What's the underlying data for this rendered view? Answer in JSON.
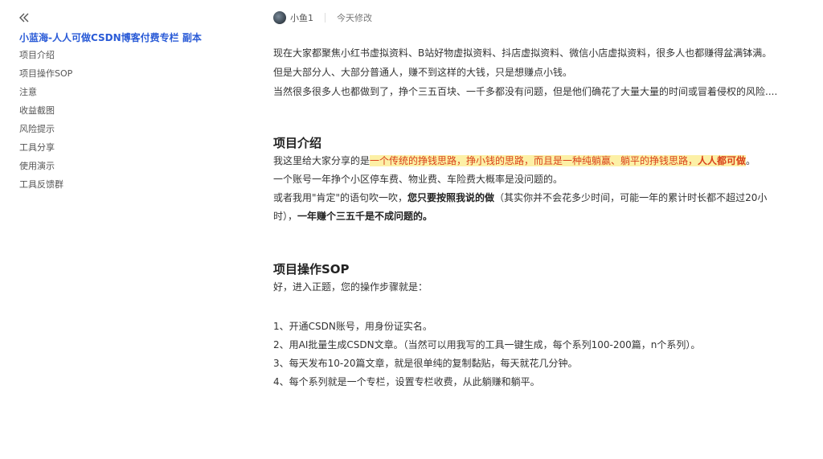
{
  "sidebar": {
    "doc_title": "小蓝海-人人可做CSDN博客付费专栏 副本",
    "toc": [
      "项目介绍",
      "项目操作SOP",
      "注意",
      "收益截图",
      "风险提示",
      "工具分享",
      "使用演示",
      "工具反馈群"
    ]
  },
  "topbar": {
    "author": "小鱼1",
    "modified": "今天修改"
  },
  "intro": {
    "p1": "现在大家都聚焦小红书虚拟资料、B站好物虚拟资料、抖店虚拟资料、微信小店虚拟资料，很多人也都赚得盆满钵满。",
    "p2": "但是大部分人、大部分普通人，赚不到这样的大钱，只是想赚点小钱。",
    "p3": "当然很多很多人也都做到了，挣个三五百块、一千多都没有问题，但是他们确花了大量大量的时间或冒着侵权的风险...."
  },
  "section1": {
    "heading": "项目介绍",
    "p1_a": "我这里给大家分享的是",
    "p1_hl": "一个传统的挣钱思路，挣小钱的思路，而且是一种纯躺赢、躺平的挣钱思路，",
    "p1_hl_bold": "人人都可做",
    "p1_end": "。",
    "p2": "一个账号一年挣个小区停车费、物业费、车险费大概率是没问题的。",
    "p3_a": "或者我用\"肯定\"的语句吹一吹，",
    "p3_b": "您只要按照我说的做",
    "p3_c": "（其实你并不会花多少时间，可能一年的累计时长都不超过20小时），",
    "p3_d": "一年赚个三五千是不成问题的。"
  },
  "section2": {
    "heading": "项目操作SOP",
    "lead": "好，进入正题，您的操作步骤就是：",
    "steps": [
      "1、开通CSDN账号，用身份证实名。",
      "2、用AI批量生成CSDN文章。（当然可以用我写的工具一键生成，每个系列100-200篇，n个系列）。",
      "3、每天发布10-20篇文章，就是很单纯的复制黏贴，每天就花几分钟。",
      "4、每个系列就是一个专栏，设置专栏收费，从此躺赚和躺平。"
    ]
  },
  "colors": {
    "title_blue": "#2a5bd7",
    "highlight_bg": "#fcf0a6",
    "highlight_text": "#d9421b"
  },
  "icons": {
    "collapse": "double-chevron-left-icon"
  }
}
